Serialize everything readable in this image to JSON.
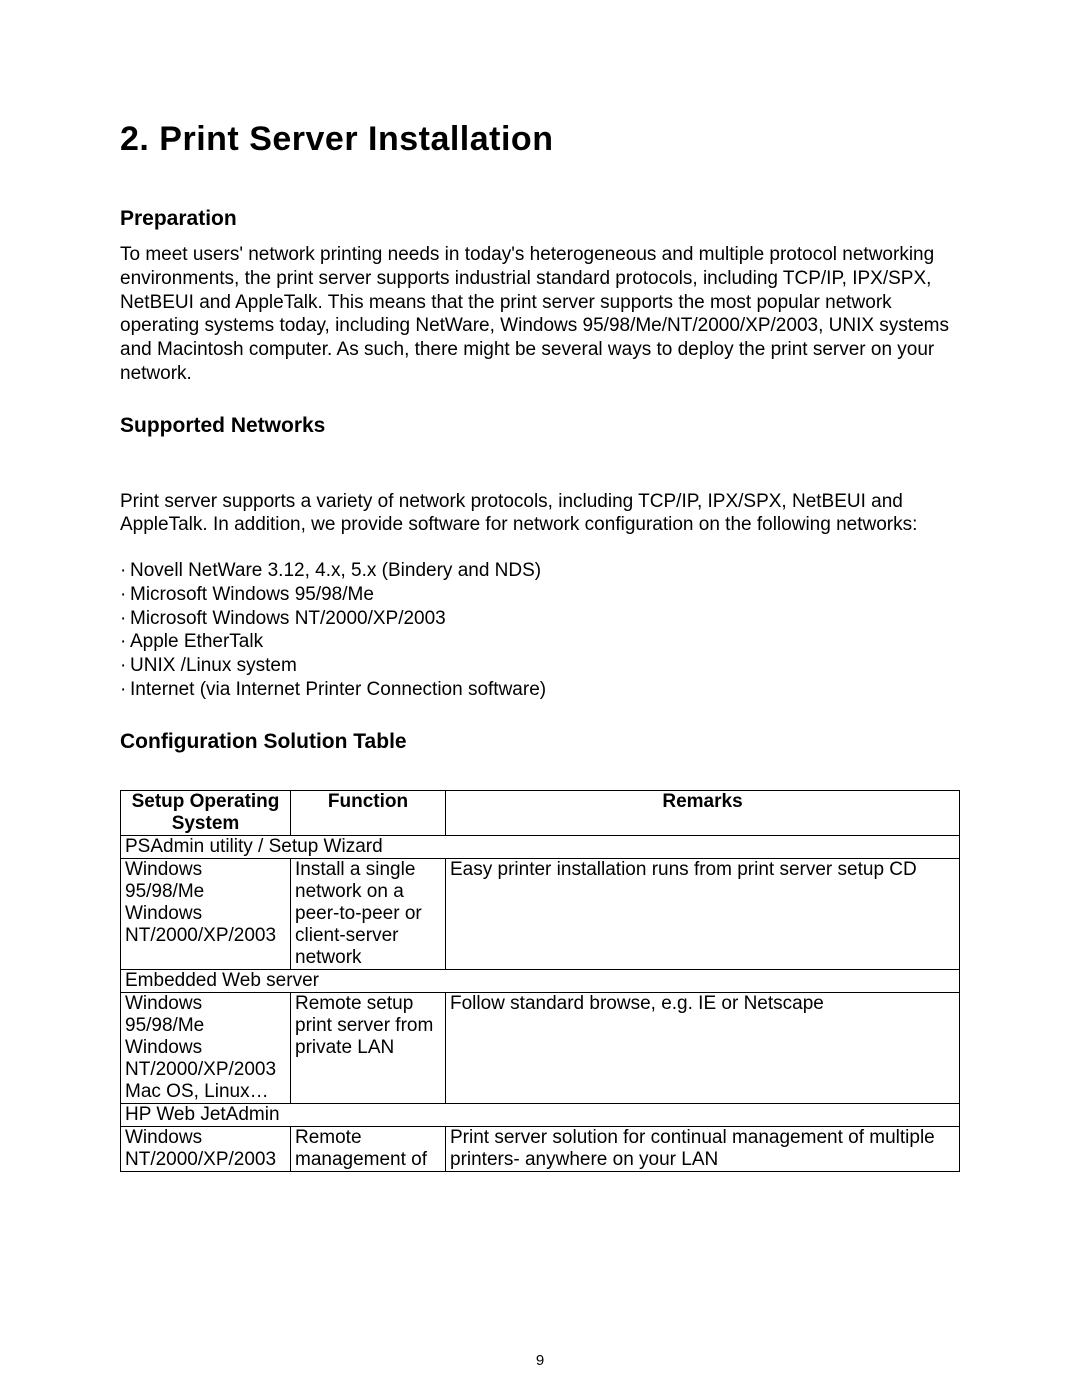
{
  "chapter_title": "2. Print Server Installation",
  "sections": {
    "preparation": {
      "heading": "Preparation",
      "body": "To meet users' network printing needs in today's heterogeneous and multiple protocol networking environments, the print server supports industrial standard protocols, including TCP/IP, IPX/SPX, NetBEUI and AppleTalk. This means that the print server supports the most popular network operating systems today, including NetWare, Windows 95/98/Me/NT/2000/XP/2003, UNIX systems and Macintosh computer. As such, there might be several ways to deploy the print server on your network."
    },
    "supported_networks": {
      "heading": "Supported Networks",
      "body": "Print server supports a variety of network protocols, including TCP/IP, IPX/SPX, NetBEUI and AppleTalk. In addition, we provide software for network configuration on the following networks:",
      "items": [
        "Novell NetWare 3.12, 4.x, 5.x (Bindery and NDS)",
        "Microsoft Windows 95/98/Me",
        "Microsoft Windows NT/2000/XP/2003",
        "Apple EtherTalk",
        "UNIX /Linux system",
        "Internet (via Internet Printer Connection software)"
      ]
    },
    "config_table": {
      "heading": "Configuration Solution Table",
      "headers": {
        "os": "Setup Operating System",
        "function": "Function",
        "remarks": "Remarks"
      },
      "groups": [
        {
          "title": "PSAdmin utility / Setup Wizard",
          "row": {
            "os": "Windows 95/98/Me Windows NT/2000/XP/2003",
            "function": "Install a single network on a peer-to-peer or client-server network",
            "remarks": "Easy printer installation runs from print server setup CD"
          }
        },
        {
          "title": "Embedded Web server",
          "row": {
            "os": "Windows 95/98/Me Windows NT/2000/XP/2003 Mac OS, Linux…",
            "function": "Remote setup print server from private LAN",
            "remarks": "Follow standard browse, e.g. IE or Netscape"
          }
        },
        {
          "title": "HP Web JetAdmin",
          "row": {
            "os": "Windows NT/2000/XP/2003",
            "function": "Remote management of",
            "remarks": "Print server solution for continual management of multiple printers- anywhere on your LAN"
          }
        }
      ]
    }
  },
  "page_number": "9"
}
